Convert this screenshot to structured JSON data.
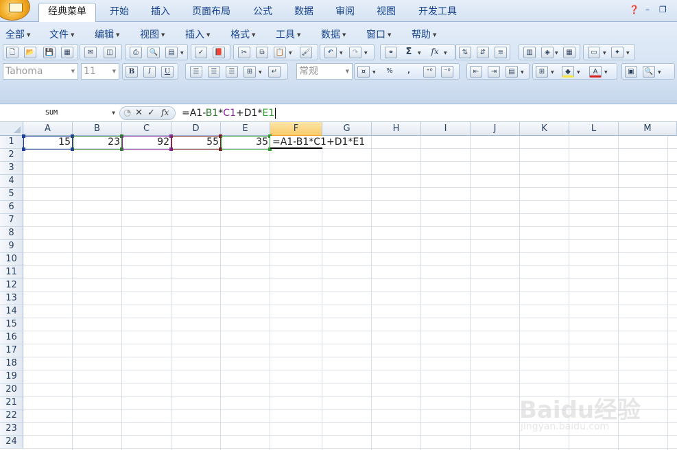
{
  "ribbon_tabs": [
    "经典菜单",
    "开始",
    "插入",
    "页面布局",
    "公式",
    "数据",
    "审阅",
    "视图",
    "开发工具"
  ],
  "active_tab": "经典菜单",
  "menu": [
    "全部",
    "文件",
    "编辑",
    "视图",
    "插入",
    "格式",
    "工具",
    "数据",
    "窗口",
    "帮助"
  ],
  "font": {
    "name": "Tahoma",
    "size": "11"
  },
  "number_format": "常规",
  "toolbar_buttons": {
    "bold": "B",
    "italic": "I",
    "underline": "U",
    "sum": "Σ",
    "function": "fx",
    "percent": "%",
    "comma": ","
  },
  "name_box": "SUM",
  "formula_bar": {
    "segments": [
      {
        "text": "=A1-",
        "color": "#1e1e1e"
      },
      {
        "text": "B1",
        "color": "#2f7a2f"
      },
      {
        "text": "*",
        "color": "#1e1e1e"
      },
      {
        "text": "C1",
        "color": "#8a2a9a"
      },
      {
        "text": "+D1*",
        "color": "#1e1e1e"
      },
      {
        "text": "E1",
        "color": "#2fa02f"
      }
    ]
  },
  "columns": [
    "A",
    "B",
    "C",
    "D",
    "E",
    "F",
    "G",
    "H",
    "I",
    "J",
    "K",
    "L",
    "M"
  ],
  "selected_column": "F",
  "rows": [
    "1",
    "2",
    "3",
    "4",
    "5",
    "6",
    "7",
    "8",
    "9",
    "10",
    "11",
    "12",
    "13",
    "14",
    "15",
    "16",
    "17",
    "18",
    "19",
    "20",
    "21",
    "22",
    "23",
    "24"
  ],
  "cells": {
    "A1": "15",
    "B1": "23",
    "C1": "92",
    "D1": "55",
    "E1": "35",
    "F1": "=A1-B1*C1+D1*E1"
  },
  "reference_colors": {
    "A1": "#1f3f99",
    "B1": "#2f7a2f",
    "C1": "#8a2a9a",
    "D1": "#7a1e1e",
    "E1": "#2fa02f"
  },
  "watermark": {
    "brand": "Baidu经验",
    "url": "jingyan.baidu.com"
  }
}
